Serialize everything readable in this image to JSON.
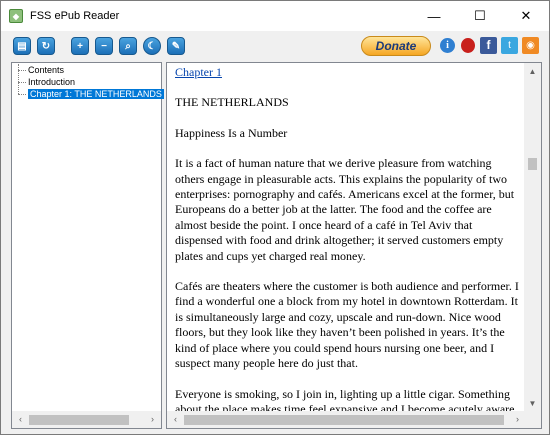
{
  "window": {
    "title": "FSS ePub Reader",
    "minimize_glyph": "—",
    "maximize_glyph": "☐",
    "close_glyph": "✕"
  },
  "toolbar": {
    "open_icon": "folder-open-icon",
    "refresh_icon": "refresh-icon",
    "zoom_in_icon": "zoom-in-icon",
    "zoom_out_icon": "zoom-out-icon",
    "search_icon": "search-icon",
    "night_icon": "moon-icon",
    "comment_icon": "speech-bubble-icon",
    "donate_label": "Donate",
    "info_glyph": "i",
    "facebook_glyph": "f",
    "twitter_glyph": "t",
    "rss_glyph": "◉"
  },
  "tree": {
    "items": [
      {
        "label": "Contents",
        "selected": false
      },
      {
        "label": "Introduction",
        "selected": false
      },
      {
        "label": "Chapter 1: THE NETHERLANDS",
        "selected": true
      }
    ]
  },
  "reader": {
    "chapter_link": "Chapter 1",
    "heading": "THE NETHERLANDS",
    "subheading": "Happiness Is a Number",
    "paragraphs": [
      "It is a fact of human nature that we derive pleasure from watching others engage in pleasurable acts. This explains the popularity of two enterprises: pornography and cafés. Americans excel at the former, but Europeans do a better job at the latter. The food and the coffee are almost beside the point. I once heard of a café in Tel Aviv that dispensed with food and drink altogether; it served customers empty plates and cups yet charged real money.",
      "Cafés are theaters where the customer is both audience and performer. I find a wonderful one a block from my hotel in downtown Rotterdam. It is simultaneously large and cozy, upscale and run-down. Nice wood floors, but they look like they haven’t been polished in years. It’s the kind of place where you could spend hours nursing one beer, and I suspect many people here do just that.",
      "Everyone is smoking, so I join in, lighting up a little cigar. Something about the place makes time feel expansive and I become acutely aware of the smallest details. I notice a woman sitting on a bar stool, her legs"
    ]
  },
  "scroll": {
    "left_arrow": "‹",
    "right_arrow": "›",
    "up_arrow": "▲",
    "down_arrow": "▼"
  },
  "colors": {
    "selection": "#0078d7",
    "link": "#0645ad",
    "donate": "#f5a623"
  }
}
